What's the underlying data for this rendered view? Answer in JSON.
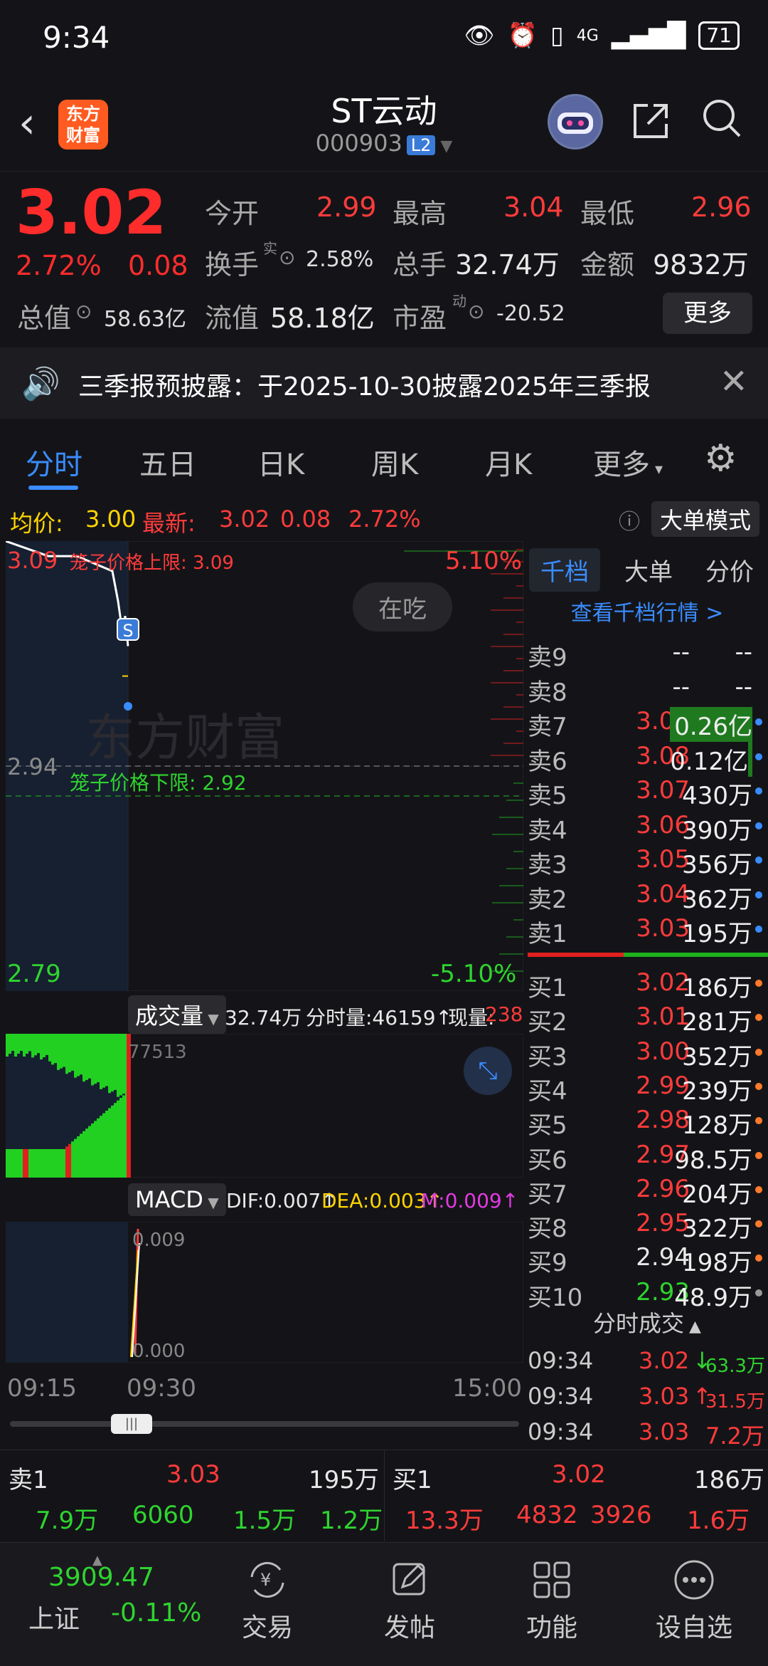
{
  "status": {
    "time": "9:34",
    "battery": "71",
    "network": "4G"
  },
  "header": {
    "logo_text": "东方财富",
    "title": "ST云动",
    "code": "000903",
    "level_badge": "L2"
  },
  "quote": {
    "price": "3.02",
    "pct": "2.72%",
    "change": "0.08",
    "open_label": "今开",
    "open": "2.99",
    "high_label": "最高",
    "high": "3.04",
    "low_label": "最低",
    "low": "2.96",
    "turnover_label": "换手",
    "turnover_sup": "实",
    "turnover": "2.58%",
    "volume_label": "总手",
    "volume": "32.74万",
    "amount_label": "金额",
    "amount": "9832万",
    "mcap_label": "总值",
    "mcap": "58.63亿",
    "float_label": "流值",
    "float": "58.18亿",
    "pe_label": "市盈",
    "pe_sup": "动",
    "pe": "-20.52",
    "more": "更多"
  },
  "notice": {
    "text": "三季报预披露：于2025-10-30披露2025年三季报"
  },
  "tabs": [
    "分时",
    "五日",
    "日K",
    "周K",
    "月K",
    "更多"
  ],
  "avgbar": {
    "avg_label": "均价:",
    "avg": "3.00",
    "last_label": "最新:",
    "last": "3.02",
    "chg": "0.08",
    "pct": "2.72%",
    "mode": "大单模式"
  },
  "chart": {
    "top_price": "3.09",
    "top_pct": "5.10%",
    "upper_limit": "笼子价格上限: 3.09",
    "mid_price": "2.94",
    "lower_limit": "笼子价格下限: 2.92",
    "bottom_price": "2.79",
    "bottom_pct": "-5.10%",
    "bubble": "在吃",
    "s_marker": "S",
    "watermark": "东方财富",
    "vol_label": "成交量",
    "vol_total": "32.74万",
    "vol_bar": "分时量:46159↑",
    "vol_now_label": "现量:",
    "vol_now": "238",
    "vol_max": "77513",
    "macd_label": "MACD",
    "dif": "DIF:0.007↑",
    "dea": "DEA:0.003↑",
    "m": "M:0.009↑",
    "macd_top": "0.009",
    "macd_bottom": "0.000",
    "time_start": "09:15",
    "time_mid": "09:30",
    "time_end": "15:00"
  },
  "chart_data": {
    "type": "line",
    "x": [
      "09:15",
      "09:20",
      "09:25",
      "09:30",
      "09:31",
      "09:32",
      "09:33",
      "09:34"
    ],
    "series": [
      {
        "name": "价格",
        "values": [
          3.09,
          3.08,
          3.08,
          3.07,
          3.05,
          3.03,
          3.04,
          3.02
        ]
      },
      {
        "name": "均价",
        "values": [
          3.0,
          3.0,
          3.0,
          3.0,
          3.0,
          3.0,
          3.0,
          3.0
        ]
      }
    ],
    "ylim": [
      2.79,
      3.09
    ]
  },
  "orderbook": {
    "tabs": [
      "千档",
      "大单",
      "分价"
    ],
    "view_link": "查看千档行情 >",
    "asks": [
      {
        "label": "卖9",
        "price": "--",
        "vol": "--",
        "pc": "w",
        "dot": ""
      },
      {
        "label": "卖8",
        "price": "--",
        "vol": "--",
        "pc": "w",
        "dot": ""
      },
      {
        "label": "卖7",
        "price": "3.09",
        "vol": "0.26亿",
        "pc": "r",
        "dot": "#3a8cff"
      },
      {
        "label": "卖6",
        "price": "3.08",
        "vol": "0.12亿",
        "pc": "r",
        "dot": "#3a8cff"
      },
      {
        "label": "卖5",
        "price": "3.07",
        "vol": "430万",
        "pc": "r",
        "dot": "#3a8cff"
      },
      {
        "label": "卖4",
        "price": "3.06",
        "vol": "390万",
        "pc": "r",
        "dot": "#3a8cff"
      },
      {
        "label": "卖3",
        "price": "3.05",
        "vol": "356万",
        "pc": "r",
        "dot": "#3a8cff"
      },
      {
        "label": "卖2",
        "price": "3.04",
        "vol": "362万",
        "pc": "r",
        "dot": "#3a8cff"
      },
      {
        "label": "卖1",
        "price": "3.03",
        "vol": "195万",
        "pc": "r",
        "dot": "#3a8cff"
      }
    ],
    "bids": [
      {
        "label": "买1",
        "price": "3.02",
        "vol": "186万",
        "pc": "r",
        "dot": "#ff7a2a"
      },
      {
        "label": "买2",
        "price": "3.01",
        "vol": "281万",
        "pc": "r",
        "dot": "#ff7a2a"
      },
      {
        "label": "买3",
        "price": "3.00",
        "vol": "352万",
        "pc": "r",
        "dot": "#ff7a2a"
      },
      {
        "label": "买4",
        "price": "2.99",
        "vol": "239万",
        "pc": "r",
        "dot": "#ff7a2a"
      },
      {
        "label": "买5",
        "price": "2.98",
        "vol": "128万",
        "pc": "r",
        "dot": "#ff7a2a"
      },
      {
        "label": "买6",
        "price": "2.97",
        "vol": "98.5万",
        "pc": "r",
        "dot": "#ff7a2a"
      },
      {
        "label": "买7",
        "price": "2.96",
        "vol": "204万",
        "pc": "r",
        "dot": "#ff7a2a"
      },
      {
        "label": "买8",
        "price": "2.95",
        "vol": "322万",
        "pc": "r",
        "dot": "#ff7a2a"
      },
      {
        "label": "买9",
        "price": "2.94",
        "vol": "198万",
        "pc": "w",
        "dot": "#ff7a2a"
      },
      {
        "label": "买10",
        "price": "2.93",
        "vol": "48.9万",
        "pc": "g",
        "dot": "#999"
      }
    ],
    "ticks_header": "分时成交",
    "ticks": [
      {
        "time": "09:34",
        "price": "3.02",
        "arrow": "↓",
        "vol": "63.3万",
        "vc": "g"
      },
      {
        "time": "09:34",
        "price": "3.03",
        "arrow": "↑",
        "vol": "31.5万",
        "vc": "r"
      },
      {
        "time": "09:34",
        "price": "3.03",
        "arrow": "",
        "vol": "7.2万",
        "vc": "r"
      }
    ]
  },
  "summary": {
    "sell_label": "卖1",
    "sell_price": "3.03",
    "sell_vol": "195万",
    "buy_label": "买1",
    "buy_price": "3.02",
    "buy_vol": "186万",
    "left_vals": [
      "7.9万",
      "6060",
      "1.5万",
      "1.2万"
    ],
    "right_vals": [
      "13.3万",
      "4832",
      "3926",
      "1.6万"
    ]
  },
  "nav": {
    "index_value": "3909.47",
    "index_name": "上证",
    "index_pct": "-0.11%",
    "items": [
      {
        "icon": "trade-icon",
        "label": "交易"
      },
      {
        "icon": "post-icon",
        "label": "发帖"
      },
      {
        "icon": "grid-icon",
        "label": "功能"
      },
      {
        "icon": "more-icon",
        "label": "设自选"
      }
    ]
  }
}
